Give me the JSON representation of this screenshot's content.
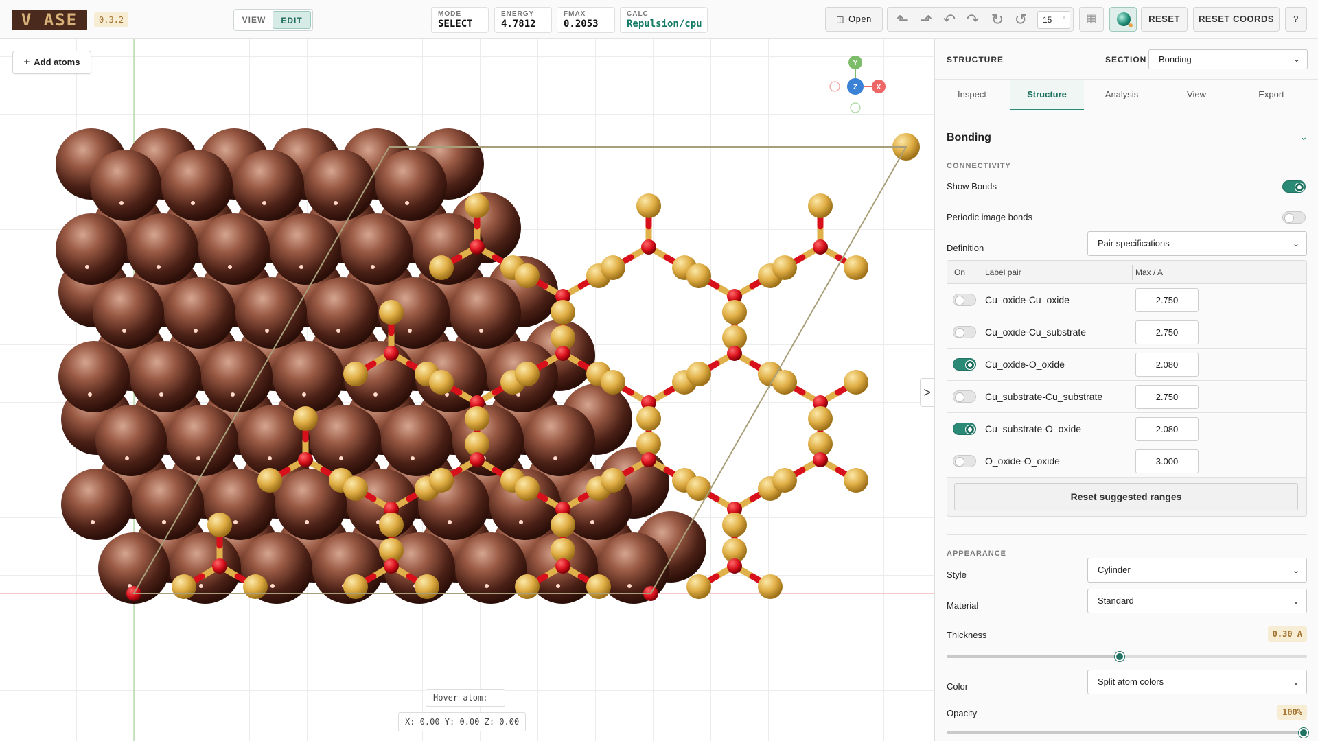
{
  "app": {
    "logo": "V ASE",
    "version": "0.3.2"
  },
  "mode_toggle": {
    "view": "VIEW",
    "edit": "EDIT",
    "active": "edit"
  },
  "stats": {
    "mode": {
      "label": "MODE",
      "value": "SELECT"
    },
    "energy": {
      "label": "ENERGY",
      "value": "4.7812"
    },
    "fmax": {
      "label": "FMAX",
      "value": "0.2053"
    },
    "calc": {
      "label": "CALC",
      "value": "Repulsion/cpu"
    }
  },
  "toolbar": {
    "open_label": "Open",
    "rotation_step": "15",
    "rotation_unit": "°",
    "reset_label": "RESET",
    "reset_coords_label": "RESET COORDS",
    "help_label": "?"
  },
  "viewport": {
    "add_atoms_label": "Add atoms",
    "add_atoms_icon": "plus-icon",
    "hover_atom": "Hover atom: –",
    "coords": "X: 0.00 Y: 0.00 Z: 0.00",
    "axes": {
      "y": "Y",
      "z": "Z",
      "x": "X"
    },
    "colors": {
      "copper": "#7a3e2b",
      "gold": "#e0b04a",
      "oxygen": "#e01020",
      "axis_x": "#e66",
      "axis_y": "#7dbd6a",
      "axis_z": "#3b82d6"
    }
  },
  "panel": {
    "title": "STRUCTURE",
    "section_label": "SECTION",
    "section_value": "Bonding",
    "tabs": [
      "Inspect",
      "Structure",
      "Analysis",
      "View",
      "Export"
    ],
    "active_tab": "Structure",
    "bonding": {
      "title": "Bonding",
      "connectivity_label": "CONNECTIVITY",
      "show_bonds_label": "Show Bonds",
      "show_bonds": true,
      "periodic_label": "Periodic image bonds",
      "periodic": false,
      "definition_label": "Definition",
      "definition_value": "Pair specifications",
      "table_headers": {
        "on": "On",
        "pair": "Label pair",
        "max": "Max / A"
      },
      "pairs": [
        {
          "label": "Cu_oxide-Cu_oxide",
          "on": false,
          "max": "2.750"
        },
        {
          "label": "Cu_oxide-Cu_substrate",
          "on": false,
          "max": "2.750"
        },
        {
          "label": "Cu_oxide-O_oxide",
          "on": true,
          "max": "2.080"
        },
        {
          "label": "Cu_substrate-Cu_substrate",
          "on": false,
          "max": "2.750"
        },
        {
          "label": "Cu_substrate-O_oxide",
          "on": true,
          "max": "2.080"
        },
        {
          "label": "O_oxide-O_oxide",
          "on": false,
          "max": "3.000"
        }
      ],
      "reset_ranges_label": "Reset suggested ranges",
      "appearance_label": "APPEARANCE",
      "style_label": "Style",
      "style_value": "Cylinder",
      "material_label": "Material",
      "material_value": "Standard",
      "thickness_label": "Thickness",
      "thickness_value": "0.30 A",
      "thickness_fraction": 0.48,
      "color_label": "Color",
      "color_value": "Split atom colors",
      "opacity_label": "Opacity",
      "opacity_value": "100%",
      "opacity_fraction": 1.0
    }
  }
}
